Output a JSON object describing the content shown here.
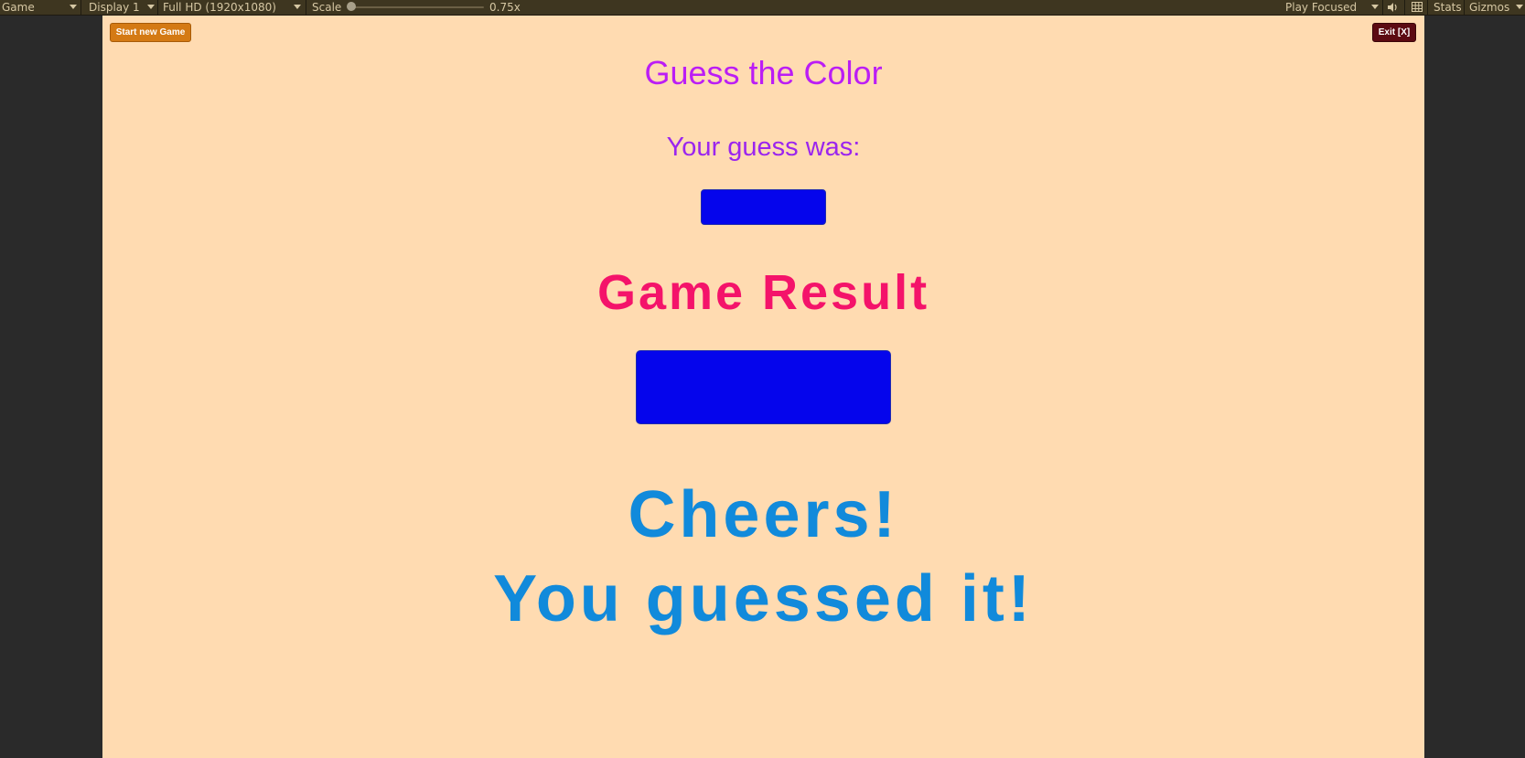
{
  "toolbar": {
    "view_label": "Game",
    "display_label": "Display 1",
    "resolution_label": "Full HD (1920x1080)",
    "scale_label": "Scale",
    "scale_value": "0.75x",
    "play_mode_label": "Play Focused",
    "stats_label": "Stats",
    "gizmos_label": "Gizmos",
    "icons": [
      "speaker-icon",
      "grid-icon",
      "chevron-down-icon"
    ]
  },
  "game": {
    "new_game_button": "Start new Game",
    "exit_button": "Exit [X]",
    "title": "Guess the Color",
    "guess_label": "Your guess was:",
    "guess_color": "#0505ec",
    "result_heading": "Game Result",
    "result_color": "#0505ec",
    "message_line1": "Cheers!",
    "message_line2": "You guessed it!"
  },
  "colors": {
    "background": "#ffdbb1",
    "title": "#bb1df5",
    "result_heading": "#f4136a",
    "message": "#118adb",
    "new_game_button": "#d47a14",
    "exit_button": "#5c0a12"
  }
}
